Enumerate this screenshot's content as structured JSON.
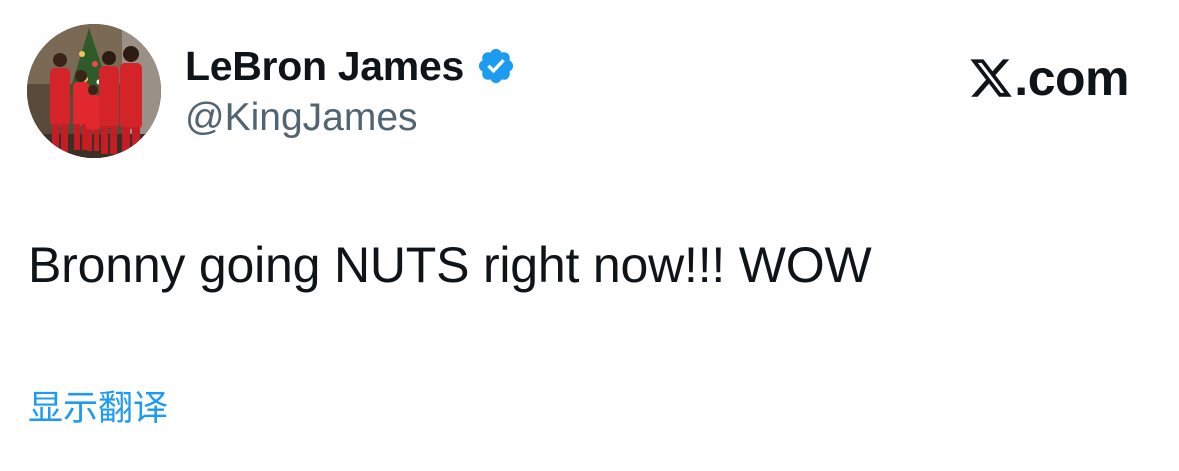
{
  "author": {
    "display_name": "LeBron James",
    "handle": "@KingJames",
    "verified": true,
    "avatar_icon": "family-photo-avatar"
  },
  "brand": {
    "logo_text": ".com",
    "logo_icon": "x-logo-icon"
  },
  "tweet": {
    "text": "Bronny going NUTS right now!!! WOW",
    "translate_label": "显示翻译"
  },
  "colors": {
    "text_primary": "#0f1419",
    "text_secondary": "#536471",
    "accent_blue": "#1d9bf0",
    "background": "#ffffff"
  }
}
